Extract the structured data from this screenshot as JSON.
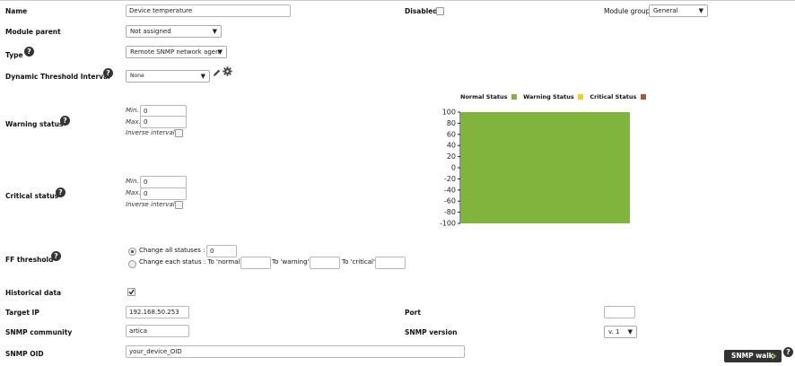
{
  "form": {
    "name_label": "Name",
    "name_value": "Device temperature",
    "disabled_label": "Disabled",
    "module_group_label": "Module group",
    "module_group_value": "General",
    "module_parent_label": "Module parent",
    "module_parent_value": "Not assigned",
    "type_label": "Type",
    "type_value": "Remote SNMP network agen",
    "dti_label": "Dynamic Threshold Interval",
    "dti_value": "None",
    "warning_label": "Warning status",
    "warning_min_label": "Min.",
    "warning_min_value": "0",
    "warning_max_label": "Max.",
    "warning_max_value": "0",
    "warning_inverse_label": "Inverse interval",
    "critical_label": "Critical status",
    "critical_min_label": "Min.",
    "critical_min_value": "0",
    "critical_max_label": "Max.",
    "critical_max_value": "0",
    "critical_inverse_label": "Inverse interval",
    "ff_label": "FF threshold",
    "ff_change_all_label": "Change all statuses :",
    "ff_change_all_value": "0",
    "ff_change_each_label": "Change each status : To 'normal'",
    "ff_to_warning_label": "To 'warning'",
    "ff_to_critical_label": "To 'critical'",
    "historical_label": "Historical data",
    "target_ip_label": "Target IP",
    "target_ip_value": "192.168.50.253",
    "port_label": "Port",
    "port_value": "",
    "snmp_community_label": "SNMP community",
    "snmp_community_value": "artica",
    "snmp_version_label": "SNMP version",
    "snmp_version_value": "v. 1",
    "snmp_oid_label": "SNMP OID",
    "snmp_oid_value": "your_device_OID",
    "snmp_walk_label": "SNMP walk",
    "help_glyph": "?"
  },
  "icons": {
    "edit": "pencil-icon",
    "settings": "gear-icon",
    "walk_arrow": "chevron-right-icon"
  },
  "chart_data": {
    "type": "bar",
    "legend": [
      {
        "name": "Normal Status",
        "color": "#80b43c"
      },
      {
        "name": "Warning Status",
        "color": "#f2cc2c"
      },
      {
        "name": "Critical Status",
        "color": "#a8593b"
      }
    ],
    "legend_position": "top",
    "yticks": [
      100,
      80,
      60,
      40,
      20,
      0,
      -20,
      -40,
      -60,
      -80,
      -100
    ],
    "ylim": [
      -100,
      100
    ],
    "regions": [
      {
        "status": "Normal Status",
        "from": -100,
        "to": 100,
        "color": "#80b43c"
      }
    ],
    "grid": false
  }
}
